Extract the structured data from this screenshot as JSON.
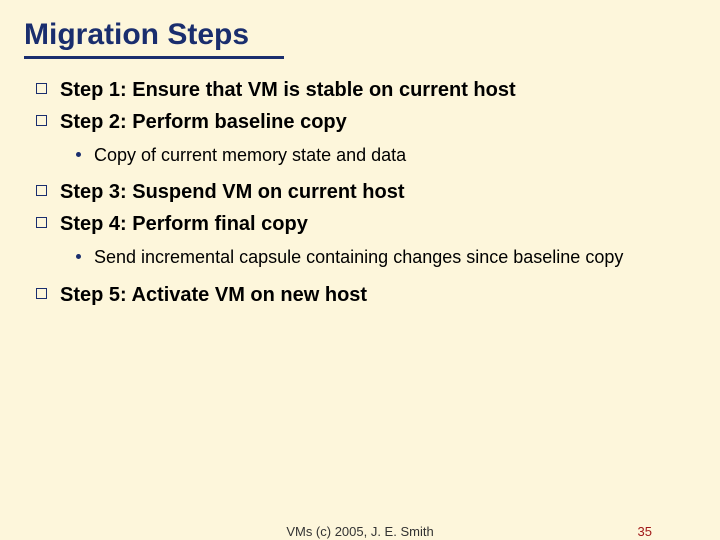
{
  "title": "Migration Steps",
  "bullets": {
    "a1": "Step 1: Ensure that VM is stable on current host",
    "a2": "Step 2: Perform baseline copy",
    "b2": "Copy of current memory state and data",
    "a3": "Step 3: Suspend VM on current host",
    "a4": "Step 4: Perform final copy",
    "b4": "Send incremental capsule containing changes since baseline copy",
    "a5": "Step 5: Activate VM on new host"
  },
  "footer": {
    "center": "VMs (c) 2005, J. E. Smith",
    "page": "35"
  }
}
